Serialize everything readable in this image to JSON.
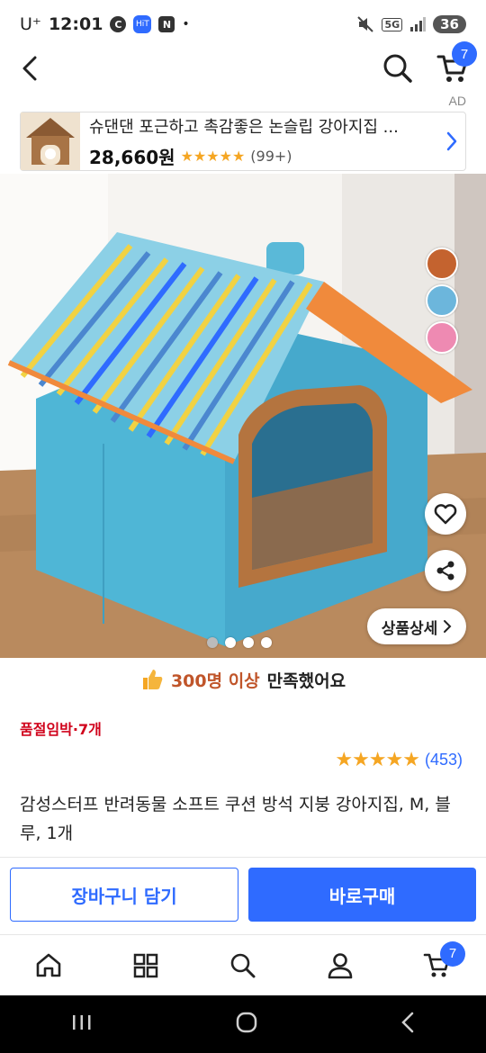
{
  "status_bar": {
    "carrier": "U⁺",
    "time": "12:01",
    "icon_c": "C",
    "icon_app": "HiT",
    "icon_n": "N",
    "dot": "•",
    "network": "5G",
    "battery": "36"
  },
  "header": {
    "cart_count": "7"
  },
  "ad": {
    "label": "AD",
    "title": "슈댄댄 포근하고 촉감좋은 논슬립 강아지집 ...",
    "price": "28,660원",
    "rating_stars": "★★★★★",
    "reviews": "(99+)"
  },
  "gallery": {
    "swatches": [
      "#c4632f",
      "#6cb6dc",
      "#ee8ab2"
    ],
    "detail_label": "상품상세",
    "dot_count": 4,
    "active_dot": 0
  },
  "satisfaction": {
    "highlight": "300명 이상",
    "text": "만족했어요"
  },
  "product": {
    "stock_label": "품절임박·7개",
    "rating_stars": "★★★★★",
    "rating_count": "(453)",
    "title": "감성스터프 반려동물 소프트 쿠션 방석 지붕 강아지집, M, 블루, 1개"
  },
  "actions": {
    "add_to_cart": "장바구니 담기",
    "buy_now": "바로구매"
  },
  "bottom_nav": {
    "items": [
      "home-icon",
      "categories-icon",
      "search-icon",
      "profile-icon",
      "cart-icon"
    ],
    "cart_count": "7"
  }
}
